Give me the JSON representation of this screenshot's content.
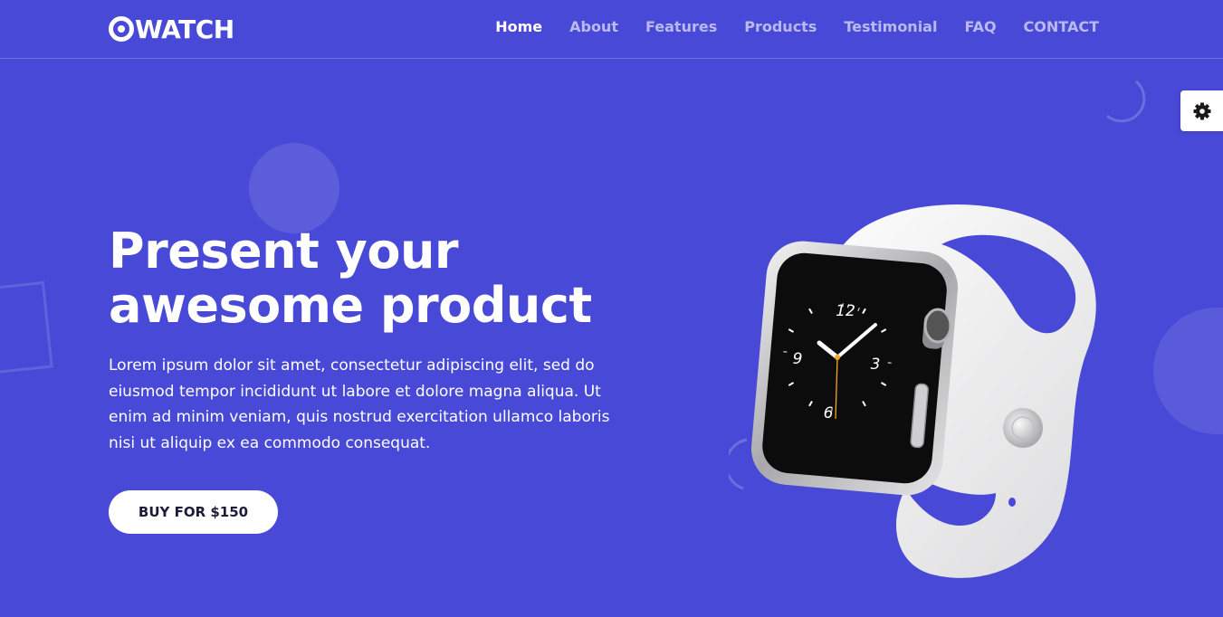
{
  "brand": {
    "name": "WATCH"
  },
  "nav": {
    "items": [
      {
        "label": "Home",
        "active": true
      },
      {
        "label": "About",
        "active": false
      },
      {
        "label": "Features",
        "active": false
      },
      {
        "label": "Products",
        "active": false
      },
      {
        "label": "Testimonial",
        "active": false
      },
      {
        "label": "FAQ",
        "active": false
      },
      {
        "label": "CONTACT",
        "active": false
      }
    ]
  },
  "hero": {
    "title_line1": "Present your",
    "title_line2": "awesome product",
    "description": "Lorem ipsum dolor sit amet, consectetur adipiscing elit, sed do eiusmod tempor incididunt ut labore et dolore magna aliqua. Ut enim ad minim veniam, quis nostrud exercitation ullamco laboris nisi ut aliquip ex ea commodo consequat.",
    "cta_label": "BUY FOR $150"
  },
  "watch_face": {
    "hour_12": "12",
    "hour_3": "3",
    "hour_6": "6",
    "hour_9": "9"
  },
  "icons": {
    "settings": "gear-icon",
    "logo": "target-icon"
  },
  "colors": {
    "background": "#4849d6",
    "text": "#ffffff",
    "button_bg": "#ffffff",
    "button_text": "#1b1b3a"
  }
}
